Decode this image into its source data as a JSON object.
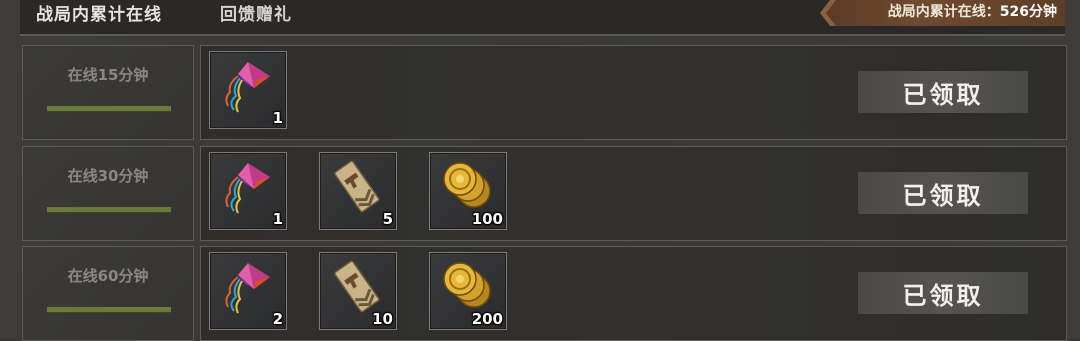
{
  "header": {
    "tab_online": "战局内累计在线",
    "tab_gift": "回馈赠礼",
    "total_label": "战局内累计在线：",
    "total_value": "526分钟"
  },
  "rows": [
    {
      "time_label": "在线15分钟",
      "progress": 1.0,
      "items": [
        {
          "icon": "kite-icon",
          "qty": "1"
        }
      ],
      "button": "已领取"
    },
    {
      "time_label": "在线30分钟",
      "progress": 1.0,
      "items": [
        {
          "icon": "kite-icon",
          "qty": "1"
        },
        {
          "icon": "pistol-badge-icon",
          "qty": "5"
        },
        {
          "icon": "gold-coins-icon",
          "qty": "100"
        }
      ],
      "button": "已领取"
    },
    {
      "time_label": "在线60分钟",
      "progress": 1.0,
      "items": [
        {
          "icon": "kite-icon",
          "qty": "2"
        },
        {
          "icon": "pistol-badge-icon",
          "qty": "10"
        },
        {
          "icon": "gold-coins-icon",
          "qty": "200"
        }
      ],
      "button": "已领取"
    }
  ]
}
